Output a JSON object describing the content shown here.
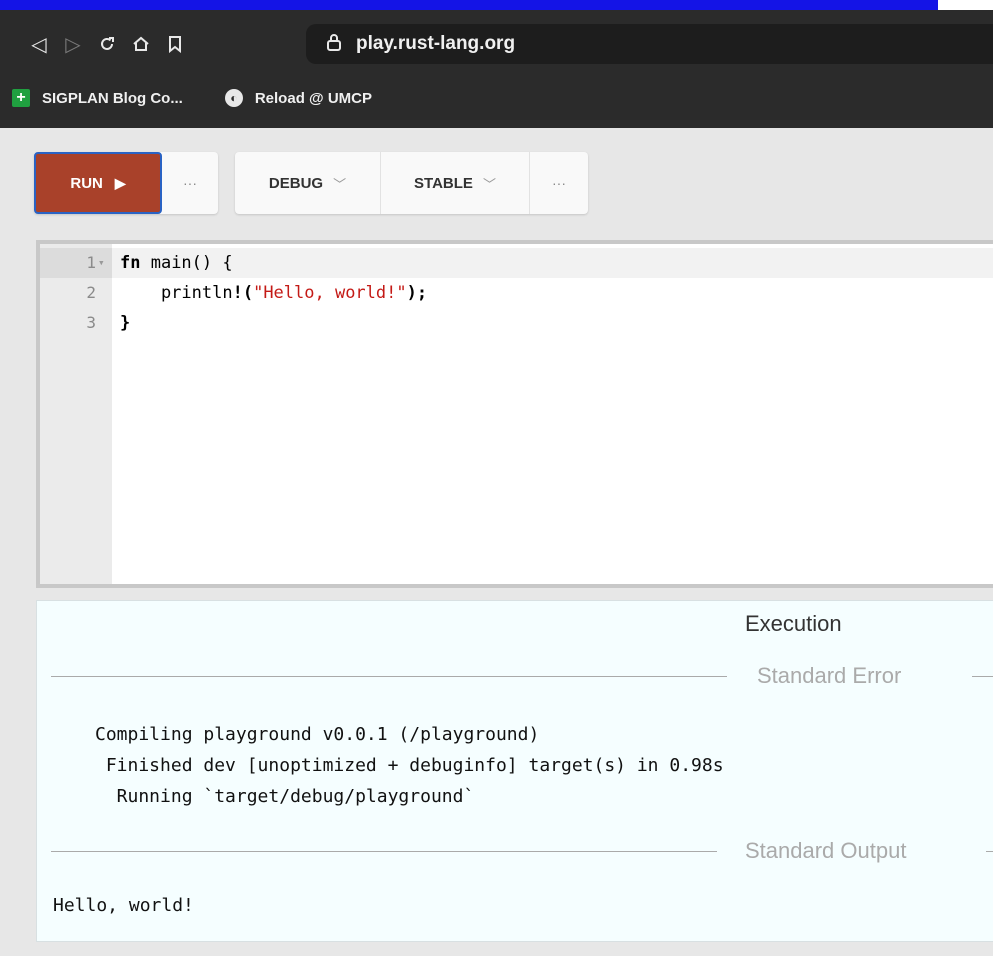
{
  "browser": {
    "url": "play.rust-lang.org",
    "bookmarks": [
      {
        "label": "SIGPLAN Blog Co..."
      },
      {
        "label": "Reload @ UMCP"
      }
    ],
    "icons": {
      "back": "back-triangle-icon",
      "forward": "forward-triangle-icon",
      "reload": "reload-icon",
      "home": "home-icon",
      "bookmark": "bookmark-icon",
      "lock": "lock-icon"
    }
  },
  "toolbar": {
    "run_label": "RUN",
    "more_label": "···",
    "mode_label": "DEBUG",
    "channel_label": "STABLE",
    "advanced_label": "···",
    "run_color": "#a9412a"
  },
  "editor": {
    "line_numbers": [
      "1",
      "2",
      "3"
    ],
    "lines": {
      "l1_kw": "fn",
      "l1_rest": " main() {",
      "l2_indent": "    println",
      "l2_bang": "!(",
      "l2_str": "\"Hello, world!\"",
      "l2_end": ");",
      "l3": "}"
    }
  },
  "output": {
    "title": "Execution",
    "stderr_label": "Standard Error",
    "stderr_lines": [
      "Compiling playground v0.0.1 (/playground)",
      " Finished dev [unoptimized + debuginfo] target(s) in 0.98s",
      "  Running `target/debug/playground`"
    ],
    "stdout_label": "Standard Output",
    "stdout_text": "Hello, world!"
  }
}
